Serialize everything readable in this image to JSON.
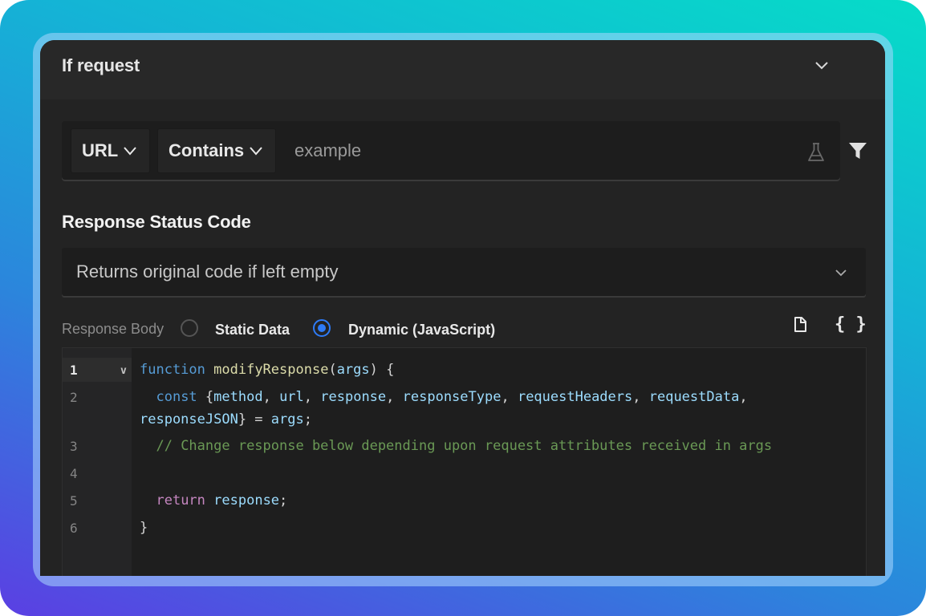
{
  "section": {
    "title": "If request"
  },
  "filter": {
    "source_key": "URL",
    "operator": "Contains",
    "value_placeholder": "example"
  },
  "status": {
    "heading": "Response Status Code",
    "placeholder": "Returns original code if left empty"
  },
  "response_body": {
    "label": "Response Body",
    "options": [
      {
        "label": "Static Data",
        "selected": false
      },
      {
        "label": "Dynamic (JavaScript)",
        "selected": true
      }
    ],
    "format_label": "{ }"
  },
  "editor": {
    "line_numbers": [
      "1",
      "2",
      "3",
      "4",
      "5",
      "6"
    ],
    "code": {
      "l1_kw": "function",
      "l1_fn": "modifyResponse",
      "l1_open": "(",
      "l1_arg": "args",
      "l1_close": ") {",
      "l2a_kw": "const",
      "l2a_open": " {",
      "l2a_vars": [
        "method",
        "url",
        "response",
        "responseType",
        "requestHeaders",
        "requestData"
      ],
      "l2b_var": "responseJSON",
      "l2b_rest": "} = ",
      "l2b_args": "args",
      "l2b_end": ";",
      "l3_comment": "// Change response below depending upon request attributes received in args",
      "l5_kw": "return",
      "l5_var": "response",
      "l5_end": ";",
      "l6": "}"
    }
  },
  "colors": {
    "accent": "#2e7bf6",
    "panel_bg": "#232323"
  }
}
